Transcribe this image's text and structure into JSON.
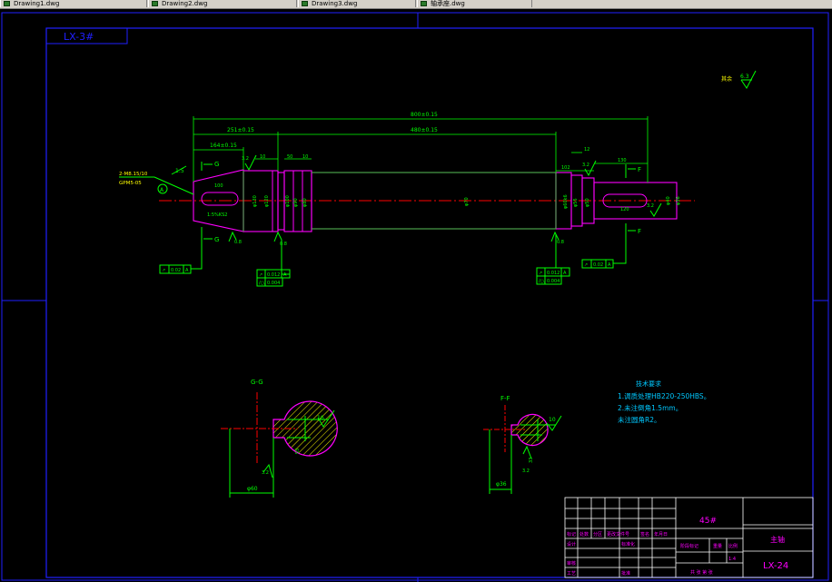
{
  "tabs": [
    {
      "label": "Drawing1.dwg"
    },
    {
      "label": "Drawing2.dwg"
    },
    {
      "label": "Drawing3.dwg"
    },
    {
      "label": "轴承座.dwg"
    }
  ],
  "drawing": {
    "drawing_code_box": "LX-3#",
    "general_roughness": "6.3",
    "overall_length": "800±0.15",
    "dim_251": "251±0.15",
    "dim_164": "164±0.15",
    "dim_480": "480±0.15",
    "thread_note_1": "2-M8.15/10",
    "thread_note_2": "GPM5-05",
    "taper_label": "1:5",
    "section_g_top": "G",
    "section_g_bottom": "G",
    "section_f_top": "F",
    "section_f_bottom": "F",
    "feature_control": "0.02",
    "datum_label": "A",
    "section_gg_title": "G-G",
    "section_ff_title": "F-F",
    "tech_req_title": "技术要求",
    "tech_req_lines": [
      "1.调质处理HB220-250HBS。",
      "2.未注倒角1.5mm。",
      "  未注圆角R2。"
    ],
    "gg_keyway_width": "16",
    "gg_depth": "55",
    "gg_diameter": "φ60",
    "ff_keyway_width": "10",
    "ff_depth": "33",
    "ff_diameter": "φ36"
  },
  "title_block": {
    "material": "45#",
    "part_name": "主轴",
    "drawing_no": "LX-24",
    "scale_label": "比例",
    "scale_value": "1:4",
    "weight_label": "重量",
    "stage_label": "阶段标记",
    "sheets_text": "共  张  第  张",
    "row_labels": [
      "标记",
      "处数",
      "分区",
      "更改文件号",
      "签名",
      "年月日"
    ],
    "role_design": "设计",
    "role_check": "审核",
    "role_process": "工艺",
    "role_approve": "批准",
    "role_std": "标准化"
  },
  "colors": {
    "frame": "#2020ff",
    "contour": "#ff00ff",
    "dimension": "#00ff00",
    "centerline": "#ff0000",
    "annotation": "#00c8ff",
    "body_outline": "#ff00ff",
    "yellow": "#ffff00",
    "white": "#ffffff"
  }
}
